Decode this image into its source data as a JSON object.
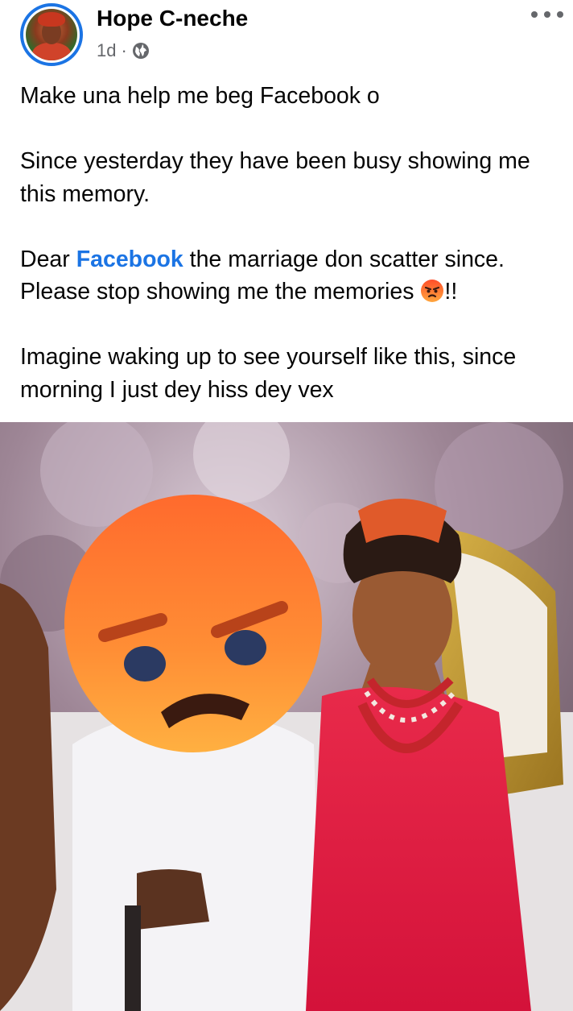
{
  "post": {
    "author": "Hope C-neche",
    "time": "1d",
    "separator": "·",
    "privacy_icon": "globe-icon",
    "more_icon": "more-options-icon",
    "text": {
      "line1": "Make una help me beg Facebook o",
      "line2": "Since yesterday they have been busy showing me this memory.",
      "line3_pre": "Dear ",
      "line3_link": "Facebook",
      "line3_post": " the marriage don scatter since. Please stop showing me the memories ",
      "line3_end": "!!",
      "line4": "Imagine waking up to see yourself like this, since morning I just dey hiss dey vex"
    },
    "emoji": "angry-face-emoji",
    "photo_content": "wedding-photo-with-angry-emoji-overlay"
  },
  "colors": {
    "link": "#1b74e4",
    "text": "#050505",
    "meta": "#65676b",
    "avatar_ring": "#1b74e4",
    "angry_top": "#ff6a3d",
    "angry_bottom": "#ffb347"
  }
}
